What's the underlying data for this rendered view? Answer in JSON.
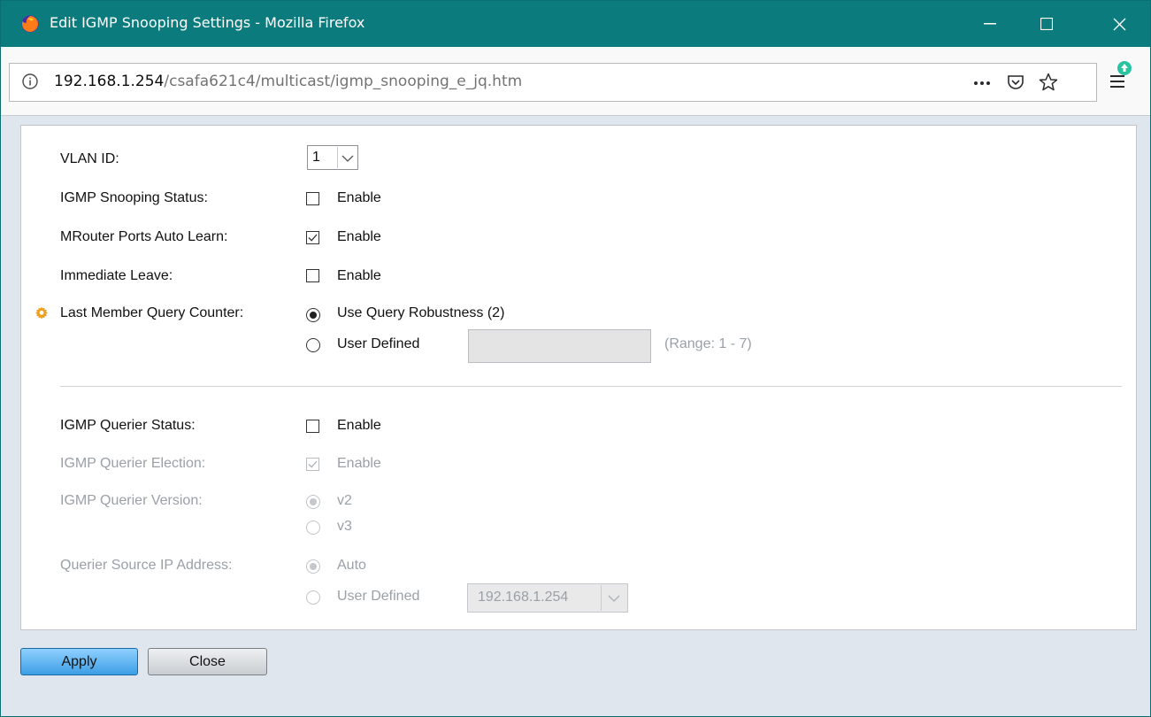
{
  "window": {
    "title": "Edit IGMP Snooping Settings - Mozilla Firefox",
    "url_host": "192.168.1.254",
    "url_path": "/csafa621c4/multicast/igmp_snooping_e_jq.htm"
  },
  "form": {
    "vlan_id_label": "VLAN ID:",
    "vlan_id_value": "1",
    "snooping_status_label": "IGMP Snooping Status:",
    "snooping_status_option": "Enable",
    "snooping_status_checked": false,
    "mrouter_label": "MRouter Ports Auto Learn:",
    "mrouter_option": "Enable",
    "mrouter_checked": true,
    "immediate_leave_label": "Immediate Leave:",
    "immediate_leave_option": "Enable",
    "immediate_leave_checked": false,
    "lmqc_label": "Last Member Query Counter:",
    "lmqc_option_robustness": "Use Query Robustness (2)",
    "lmqc_option_user": "User Defined",
    "lmqc_selected": "robustness",
    "lmqc_user_value": "",
    "lmqc_range": "(Range: 1 - 7)",
    "querier_status_label": "IGMP Querier Status:",
    "querier_status_option": "Enable",
    "querier_status_checked": false,
    "querier_election_label": "IGMP Querier Election:",
    "querier_election_option": "Enable",
    "querier_election_checked": true,
    "querier_version_label": "IGMP Querier Version:",
    "querier_version_v2": "v2",
    "querier_version_v3": "v3",
    "querier_version_selected": "v2",
    "source_ip_label": "Querier Source IP Address:",
    "source_ip_auto": "Auto",
    "source_ip_user": "User Defined",
    "source_ip_selected": "auto",
    "source_ip_value": "192.168.1.254"
  },
  "buttons": {
    "apply": "Apply",
    "close": "Close"
  },
  "colors": {
    "titlebar": "#0c7b7e",
    "apply_button": "#3d9ee5",
    "required_icon": "#f0a020"
  },
  "icons": [
    "firefox-icon",
    "minimize-icon",
    "maximize-icon",
    "close-icon",
    "info-icon",
    "more-icon",
    "pocket-icon",
    "bookmark-star-icon",
    "menu-update-icon",
    "required-gear-icon",
    "checkmark-icon",
    "chevron-down-icon"
  ]
}
